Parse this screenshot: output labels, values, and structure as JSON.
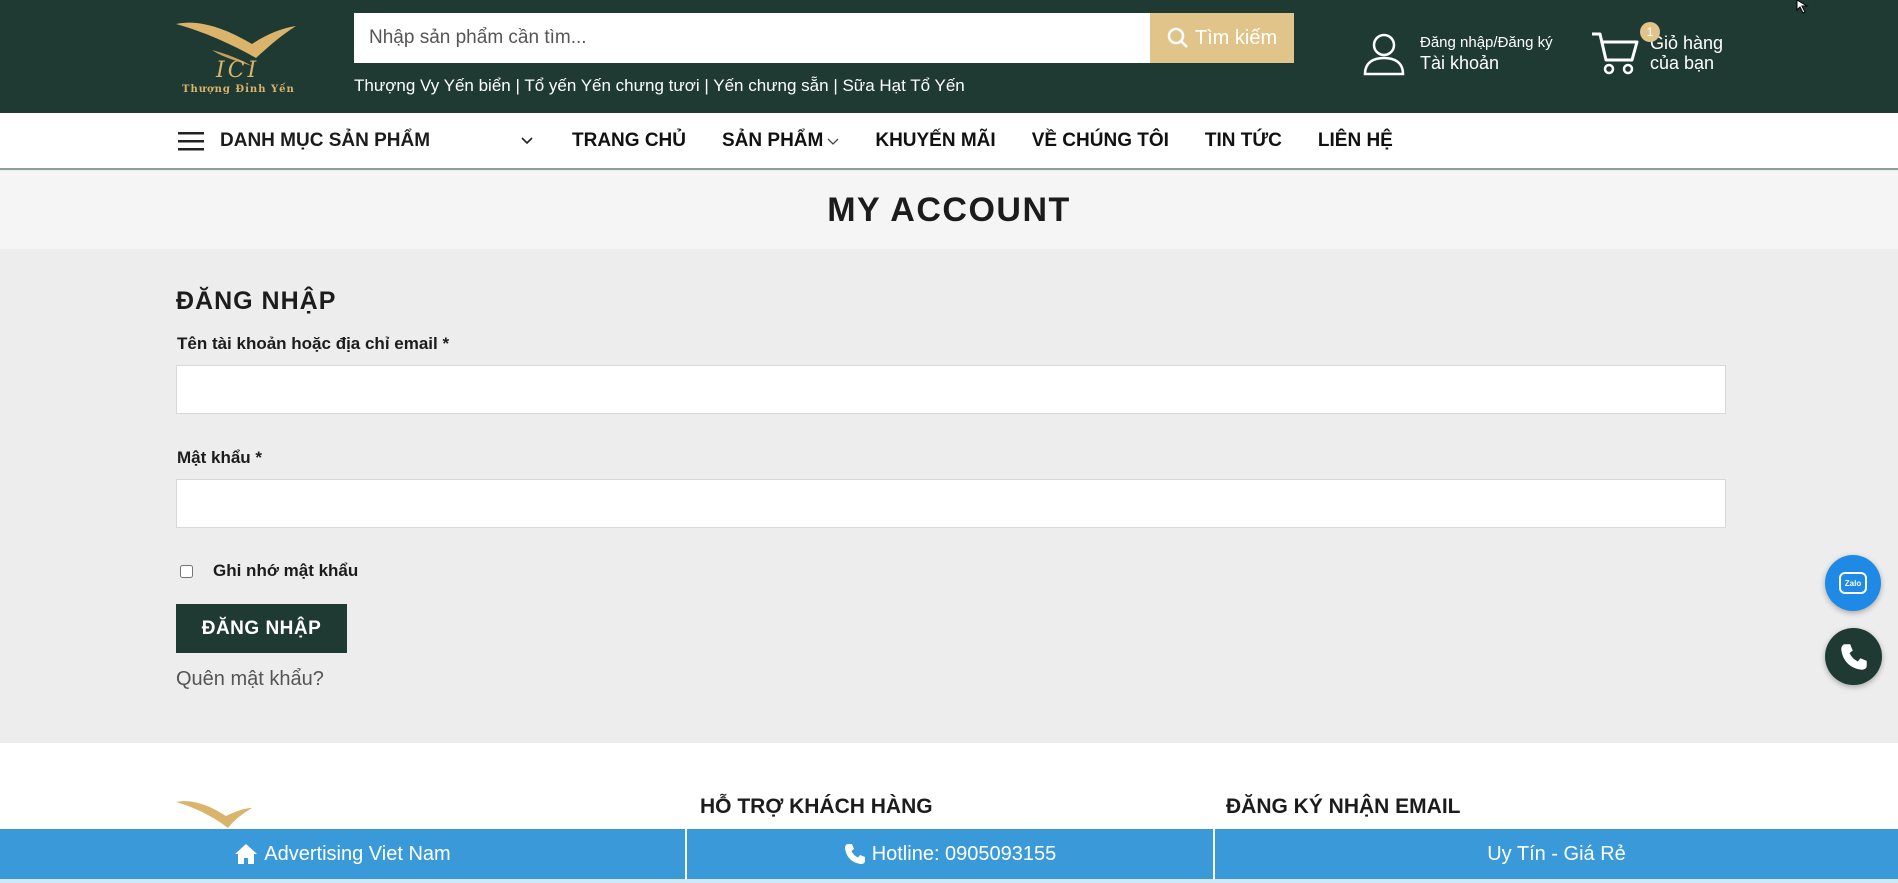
{
  "header": {
    "logo_text": "ICI",
    "logo_subtext": "Thượng Đỉnh Yến",
    "search_placeholder": "Nhập sản phẩm cần tìm...",
    "search_button": "Tìm kiếm",
    "quick_links": [
      "Thượng Vy Yến biển",
      "Tổ yến Yến chưng tươi",
      "Yến chưng sẵn",
      "Sữa Hạt Tổ Yến"
    ],
    "account_line1": "Đăng nhập/Đăng ký",
    "account_line2": "Tài khoản",
    "cart_count": "1",
    "cart_line1": "Giỏ hàng",
    "cart_line2": "của bạn"
  },
  "nav": {
    "category_label": "DANH MỤC SẢN PHẨM",
    "items": [
      "TRANG CHỦ",
      "SẢN PHẨM",
      "KHUYẾN MÃI",
      "VỀ CHÚNG TÔI",
      "TIN TỨC",
      "LIÊN HỆ"
    ]
  },
  "page_title": "MY ACCOUNT",
  "login": {
    "heading": "ĐĂNG NHẬP",
    "username_label": "Tên tài khoản hoặc địa chỉ email *",
    "username_value": "",
    "password_label": "Mật khẩu *",
    "password_value": "",
    "remember_label": "Ghi nhớ mật khẩu",
    "remember_checked": false,
    "submit_label": "ĐĂNG NHẬP",
    "forgot_label": "Quên mật khẩu?"
  },
  "footer": {
    "col1_title": "HỖ TRỢ KHÁCH HÀNG",
    "col2_title": "ĐĂNG KÝ NHẬN EMAIL"
  },
  "bottom_bar": {
    "left": "Advertising Viet Nam",
    "middle": "Hotline: 0905093155",
    "right": "Uy Tín - Giá Rẻ"
  },
  "floating": {
    "zalo_text": "Zalo"
  },
  "colors": {
    "header_bg": "#1f3a33",
    "gold": "#e0c48a",
    "bottom_bar": "#3a9ad9"
  }
}
